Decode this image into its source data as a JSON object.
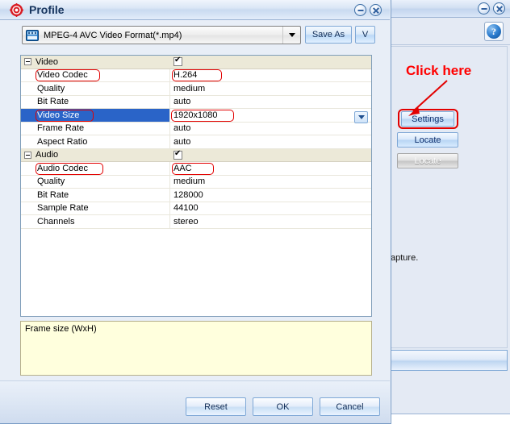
{
  "background_window": {
    "help_icon": "help-question-icon",
    "description_text": "apture.",
    "buttons": [
      {
        "label": "Settings",
        "state": "enabled",
        "highlighted": true
      },
      {
        "label": "Locate",
        "state": "enabled",
        "highlighted": false
      },
      {
        "label": "Locate",
        "state": "disabled",
        "highlighted": false
      }
    ],
    "annotation": {
      "text": "Click here",
      "color": "#ff0000",
      "arrow": "red-arrow-pointing-to-settings"
    },
    "window_controls": [
      "minimize-icon",
      "close-icon"
    ]
  },
  "dialog": {
    "title": "Profile",
    "icon": "profile-gear-icon",
    "window_controls": [
      "minimize-icon",
      "close-icon"
    ],
    "format": {
      "icon": "video-file-icon",
      "value": "MPEG-4 AVC Video Format(*.mp4)",
      "caret": "chevron-down-icon"
    },
    "save_as_label": "Save As",
    "v_label": "V",
    "grid": {
      "groups": [
        {
          "name": "Video",
          "checked": true,
          "expanded": true,
          "rows": [
            {
              "name": "Video Codec",
              "value": "H.264",
              "highlight_name": true,
              "highlight_value": true
            },
            {
              "name": "Quality",
              "value": "medium"
            },
            {
              "name": "Bit Rate",
              "value": "auto"
            },
            {
              "name": "Video Size",
              "value": "1920x1080",
              "selected": true,
              "editing": true,
              "highlight_name": true,
              "highlight_value": true,
              "has_dropdown": true
            },
            {
              "name": "Frame Rate",
              "value": "auto"
            },
            {
              "name": "Aspect Ratio",
              "value": "auto"
            }
          ]
        },
        {
          "name": "Audio",
          "checked": true,
          "expanded": true,
          "rows": [
            {
              "name": "Audio Codec",
              "value": "AAC",
              "highlight_name": true,
              "highlight_value": true
            },
            {
              "name": "Quality",
              "value": "medium"
            },
            {
              "name": "Bit Rate",
              "value": "128000"
            },
            {
              "name": "Sample Rate",
              "value": "44100"
            },
            {
              "name": "Channels",
              "value": "stereo"
            }
          ]
        }
      ]
    },
    "description": "Frame size (WxH)",
    "buttons": {
      "reset": "Reset",
      "ok": "OK",
      "cancel": "Cancel"
    }
  },
  "colors": {
    "selection_blue": "#2a64c8",
    "annotation_red": "#e20000",
    "group_row": "#ece9d8",
    "description_bg": "#ffffdd"
  }
}
